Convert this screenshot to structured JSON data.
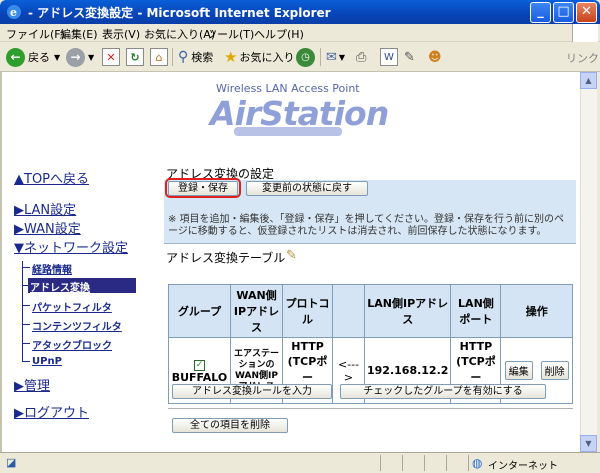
{
  "window": {
    "title": "- アドレス変換設定 - Microsoft Internet Explorer",
    "controls": [
      "_",
      "□",
      "✕"
    ]
  },
  "menu": [
    "ファイル(F)",
    "編集(E)",
    "表示(V)",
    "お気に入り(A)",
    "ツール(T)",
    "ヘルプ(H)"
  ],
  "toolbar": {
    "back": "戻る",
    "search": "検索",
    "favorites": "お気に入り",
    "links": "リンク"
  },
  "logo": {
    "subtitle": "Wireless LAN Access Point",
    "name": "AirStation"
  },
  "nav": {
    "top": "▲TOPへ戻る",
    "lan": "▶LAN設定",
    "wan": "▶WAN設定",
    "network": "▼ネットワーク設定",
    "sub": [
      "経路情報",
      "アドレス変換",
      "パケットフィルタ",
      "コンテンツフィルタ",
      "アタックブロック",
      "UPnP"
    ],
    "manage": "▶管理",
    "logout": "▶ログアウト"
  },
  "settings": {
    "title": "アドレス変換の設定",
    "save_button": "登録・保存",
    "revert_button": "変更前の状態に戻す",
    "note": "※ 項目を追加・編集後、「登録・保存」を押してください。登録・保存を行う前に別のページに移動すると、仮登録されたリストは消去され、前回保存した状態になります。"
  },
  "table": {
    "title": "アドレス変換テーブル",
    "headers": [
      "グループ",
      "WAN側IPアドレス",
      "プロトコル",
      "",
      "LAN側IPアドレス",
      "LAN側ポート",
      "操作"
    ],
    "row": {
      "group": "BUFFALO",
      "wan_ip": "エアステーションのWAN側IPアドレス",
      "protocol": "HTTP (TCPポート:80)",
      "arrow": "<--->",
      "lan_ip": "192.168.12.2",
      "lan_port": "HTTP (TCPポート:80)",
      "edit": "編集",
      "delete": "削除"
    },
    "add_button": "アドレス変換ルールを入力",
    "enable_button": "チェックしたグループを有効にする",
    "delete_all_button": "全ての項目を削除"
  },
  "status": {
    "zone": "インターネット"
  }
}
